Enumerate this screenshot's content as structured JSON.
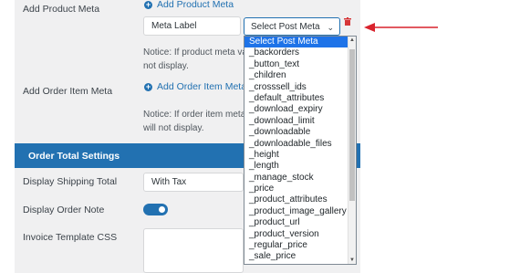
{
  "labels": {
    "add_product_meta": "Add Product Meta",
    "add_order_item_meta": "Add Order Item Meta",
    "display_shipping_total": "Display Shipping Total",
    "display_order_note": "Display Order Note",
    "invoice_template_css": "Invoice Template CSS"
  },
  "links": {
    "add_product_meta": "Add Product Meta",
    "add_order_item_meta": "Add Order Item Meta"
  },
  "meta_label_input": {
    "value": "Meta Label"
  },
  "post_meta_select": {
    "value": "Select Post Meta"
  },
  "notices": {
    "product_line1": "Notice: If product meta va",
    "product_line2": "not display.",
    "order_line1": "Notice: If order item meta",
    "order_line2": "will not display."
  },
  "section": {
    "title": "Order Total Settings"
  },
  "shipping_select": {
    "value": "With Tax"
  },
  "order_note_toggle": {
    "state": "on"
  },
  "dropdown_options": [
    "Select Post Meta",
    "_backorders",
    "_button_text",
    "_children",
    "_crosssell_ids",
    "_default_attributes",
    "_download_expiry",
    "_download_limit",
    "_downloadable",
    "_downloadable_files",
    "_height",
    "_length",
    "_manage_stock",
    "_price",
    "_product_attributes",
    "_product_image_gallery",
    "_product_url",
    "_product_version",
    "_regular_price",
    "_sale_price"
  ],
  "colors": {
    "accent": "#2271b1",
    "selected_option": "#1e73e8",
    "annotation_arrow": "#d9232d",
    "delete_icon": "#d63638"
  }
}
